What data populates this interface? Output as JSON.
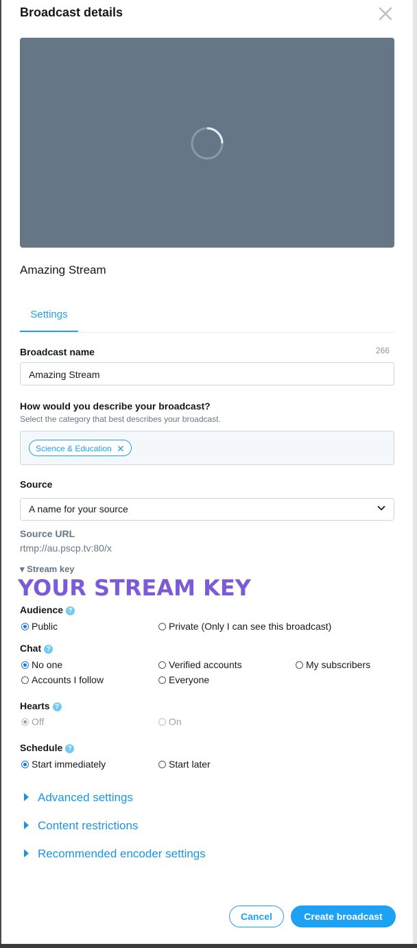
{
  "dialog": {
    "title": "Broadcast details"
  },
  "preview": {
    "stream_name": "Amazing Stream"
  },
  "tabs": [
    {
      "label": "Settings"
    }
  ],
  "broadcast_name": {
    "label": "Broadcast name",
    "counter": "266",
    "value": "Amazing Stream"
  },
  "category": {
    "label": "How would you describe your broadcast?",
    "hint": "Select the category that best describes your broadcast.",
    "selected": "Science & Education"
  },
  "source": {
    "label": "Source",
    "selected": "A name for your source",
    "url_label": "Source URL",
    "url": "rtmp://au.pscp.tv:80/x",
    "stream_key_label": "Stream key",
    "stream_key_overlay": "YOUR STREAM KEY"
  },
  "audience": {
    "label": "Audience",
    "options": [
      {
        "label": "Public",
        "selected": true
      },
      {
        "label": "Private (Only I can see this broadcast)",
        "selected": false
      }
    ]
  },
  "chat": {
    "label": "Chat",
    "options": [
      {
        "label": "No one",
        "selected": true
      },
      {
        "label": "Verified accounts",
        "selected": false
      },
      {
        "label": "My subscribers",
        "selected": false
      },
      {
        "label": "Accounts I follow",
        "selected": false
      },
      {
        "label": "Everyone",
        "selected": false
      }
    ]
  },
  "hearts": {
    "label": "Hearts",
    "options": [
      {
        "label": "Off",
        "selected": true
      },
      {
        "label": "On",
        "selected": false
      }
    ]
  },
  "schedule": {
    "label": "Schedule",
    "options": [
      {
        "label": "Start immediately",
        "selected": true
      },
      {
        "label": "Start later",
        "selected": false
      }
    ]
  },
  "expanders": [
    {
      "label": "Advanced settings"
    },
    {
      "label": "Content restrictions"
    },
    {
      "label": "Recommended encoder settings"
    }
  ],
  "actions": {
    "cancel": "Cancel",
    "create": "Create broadcast"
  },
  "colors": {
    "accent": "#1da1f2",
    "preview_bg": "#657786",
    "overlay": "#7b5cd6"
  }
}
